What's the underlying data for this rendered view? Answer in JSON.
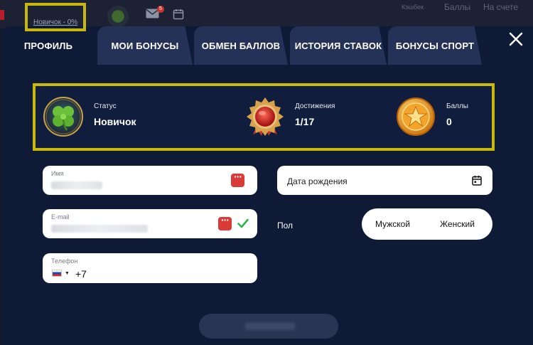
{
  "topbar": {
    "level_chip": "Новичок - 0%",
    "mail_badge": "5",
    "links": [
      "Кэшбек",
      "Баллы",
      "На счете"
    ]
  },
  "tabs": [
    {
      "label": "ПРОФИЛЬ",
      "active": true
    },
    {
      "label": "МОИ БОНУСЫ",
      "active": false
    },
    {
      "label": "ОБМЕН БАЛЛОВ",
      "active": false
    },
    {
      "label": "ИСТОРИЯ СТАВОК",
      "active": false
    },
    {
      "label": "БОНУСЫ СПОРТ",
      "active": false
    }
  ],
  "stats": {
    "status": {
      "label": "Статус",
      "value": "Новичок",
      "icon": "clover-badge-icon"
    },
    "achievements": {
      "label": "Достижения",
      "value": "1/17",
      "icon": "medal-icon"
    },
    "points": {
      "label": "Баллы",
      "value": "0",
      "icon": "star-coin-icon"
    }
  },
  "form": {
    "name": {
      "label": "Имя"
    },
    "email": {
      "label": "E-mail"
    },
    "phone": {
      "label": "Телефон",
      "code": "+7"
    },
    "birthdate": {
      "placeholder": "Дата рождения"
    },
    "gender": {
      "label": "Пол",
      "options": [
        "Мужской",
        "Женский"
      ]
    }
  },
  "colors": {
    "highlight": "#c8b80a",
    "modal_bg": "#0f1a36",
    "tab_bg": "#243258",
    "danger": "#d93b38",
    "success": "#2fb24c"
  }
}
